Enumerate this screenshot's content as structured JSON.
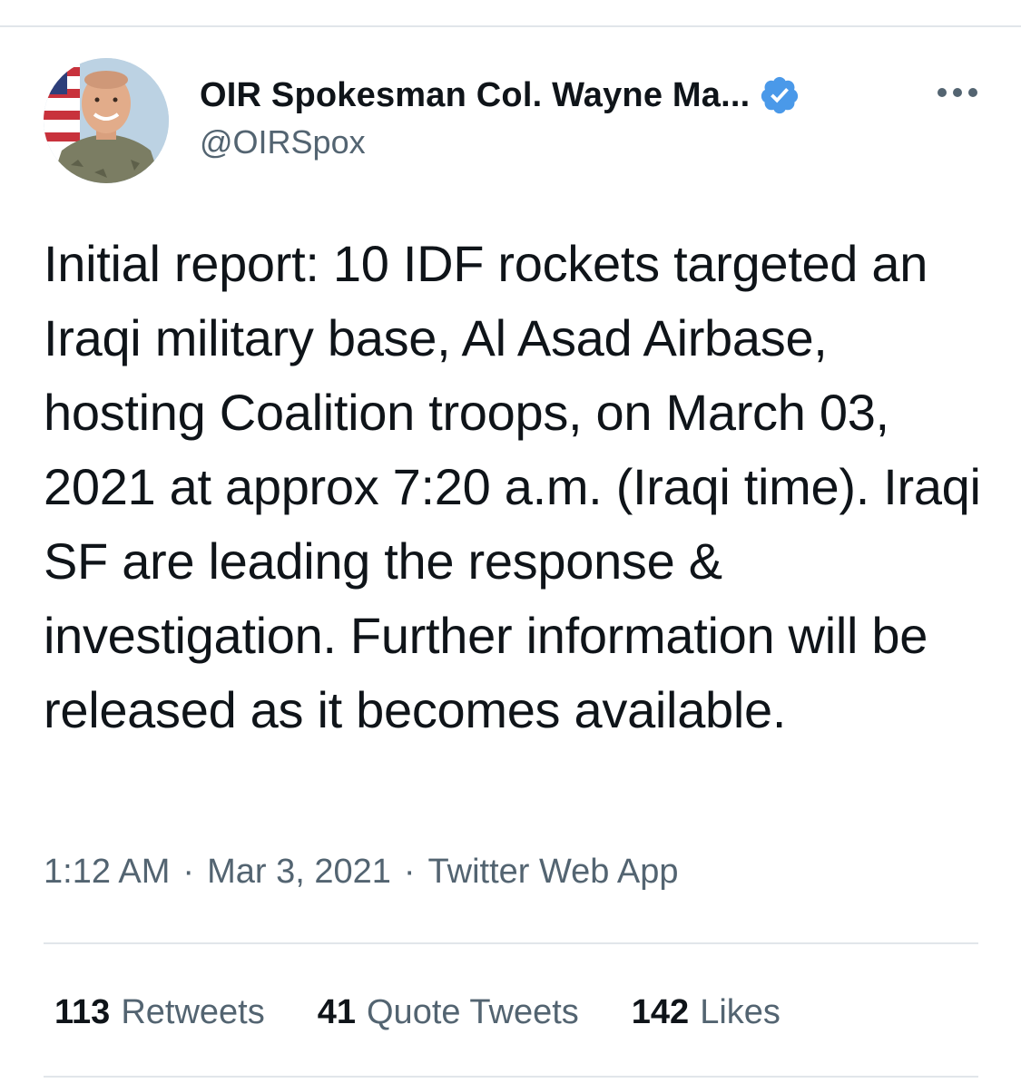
{
  "author": {
    "display_name": "OIR Spokesman Col. Wayne Ma...",
    "handle": "@OIRSpox",
    "verified": true,
    "verified_color": "#4a99e9"
  },
  "icons": {
    "avatar": "profile-photo",
    "verified": "verified-badge-icon",
    "more": "more-horizontal-icon"
  },
  "tweet": {
    "text": "Initial report: 10 IDF rockets targeted an Iraqi military base, Al Asad Airbase, hosting Coalition troops, on March 03, 2021 at approx 7:20 a.m. (Iraqi time). Iraqi SF are leading the response & investigation. Further information will be released as it becomes available.",
    "time": "1:12 AM",
    "separator": "·",
    "date": "Mar 3, 2021",
    "source": "Twitter Web App"
  },
  "stats": {
    "retweets_count": "113",
    "retweets_label": "Retweets",
    "quotes_count": "41",
    "quotes_label": "Quote Tweets",
    "likes_count": "142",
    "likes_label": "Likes"
  },
  "colors": {
    "text_primary": "#0f1419",
    "text_secondary": "#536471",
    "divider": "#e1e6ea"
  }
}
